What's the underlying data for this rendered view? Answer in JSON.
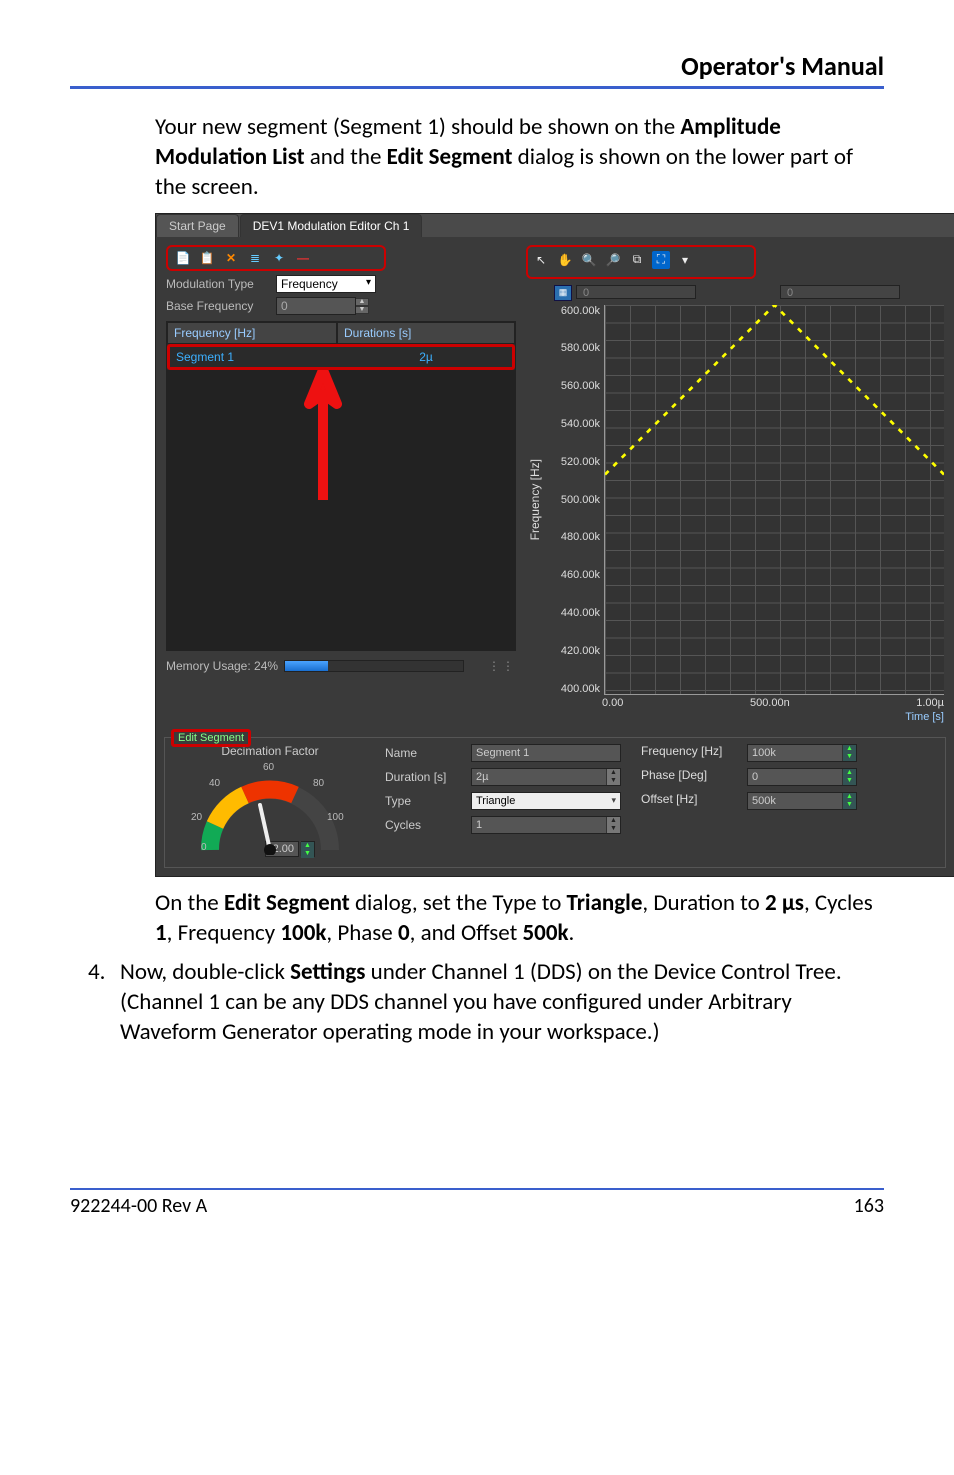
{
  "header": {
    "title": "Operator's Manual"
  },
  "para1": {
    "t1": "Your new segment (Segment 1) should be shown on the ",
    "b1": "Amplitude Modulation List",
    "t2": " and the ",
    "b2": "Edit Segment",
    "t3": " dialog is shown on the lower part of the screen."
  },
  "para2": {
    "t1": "On the ",
    "b1": "Edit Segment",
    "t2": " dialog, set the Type to ",
    "b2": "Triangle",
    "t3": ", Duration to ",
    "b3": "2 µs",
    "t4": ", Cycles ",
    "b4": "1",
    "t5": ", Frequency ",
    "b5": "100k",
    "t6": ", Phase ",
    "b6": "0",
    "t7": ", and Offset ",
    "b7": "500k",
    "t8": "."
  },
  "step4": {
    "num": "4.",
    "t1": "Now, double-click ",
    "b1": "Settings",
    "t2": " under Channel 1 (DDS) on the Device Control Tree. (Channel 1 can be any DDS channel you have configured under Arbitrary Waveform Generator operating mode in your workspace.)"
  },
  "footer": {
    "left": "922244-00 Rev A",
    "right": "163"
  },
  "shot": {
    "tabs": {
      "start": "Start Page",
      "editor": "DEV1 Modulation Editor Ch 1"
    },
    "left": {
      "modType": {
        "label": "Modulation Type",
        "value": "Frequency"
      },
      "baseFreq": {
        "label": "Base Frequency",
        "value": "0"
      },
      "tableHead": {
        "c1": "Frequency [Hz]",
        "c2": "Durations [s]"
      },
      "seg": {
        "name": "Segment 1",
        "dur": "2µ"
      },
      "mem": {
        "label": "Memory Usage: 24%",
        "pct": 24
      }
    },
    "right": {
      "range": {
        "a": "0",
        "b": "0"
      },
      "xlabel": "Time [s]"
    },
    "edit": {
      "title": "Edit Segment",
      "gauge": {
        "label": "Decimation Factor",
        "ticks": [
          "0",
          "20",
          "40",
          "60",
          "80",
          "100"
        ],
        "value": "2.00"
      },
      "name": {
        "label": "Name",
        "value": "Segment 1"
      },
      "duration": {
        "label": "Duration [s]",
        "value": "2µ"
      },
      "type": {
        "label": "Type",
        "value": "Triangle"
      },
      "cycles": {
        "label": "Cycles",
        "value": "1"
      },
      "freq": {
        "label": "Frequency [Hz]",
        "value": "100k"
      },
      "phase": {
        "label": "Phase [Deg]",
        "value": "0"
      },
      "offset": {
        "label": "Offset [Hz]",
        "value": "500k"
      }
    }
  },
  "chart_data": {
    "type": "line",
    "title": "",
    "xlabel": "Time [s]",
    "ylabel": "Frequency [Hz]",
    "x_ticks": [
      "0.00",
      "500.00n",
      "1.00µ"
    ],
    "y_ticks": [
      "400.00k",
      "420.00k",
      "440.00k",
      "460.00k",
      "480.00k",
      "500.00k",
      "520.00k",
      "540.00k",
      "560.00k",
      "580.00k",
      "600.00k"
    ],
    "ylim": [
      400000,
      600000
    ],
    "xlim": [
      0,
      1e-06
    ],
    "series": [
      {
        "name": "Segment 1",
        "style": "dotted-yellow",
        "x": [
          0,
          5e-07,
          1e-06
        ],
        "y": [
          500000,
          600000,
          500000
        ]
      }
    ]
  }
}
